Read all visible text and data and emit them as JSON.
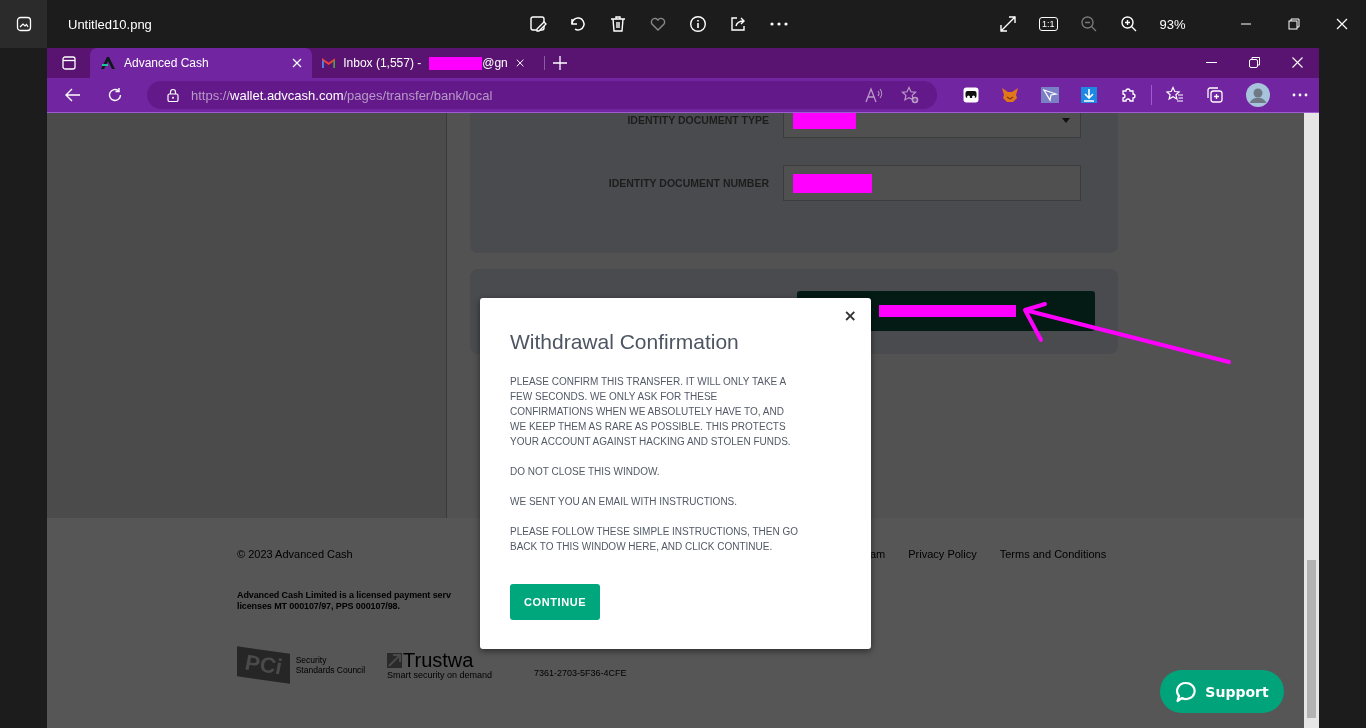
{
  "viewer": {
    "file_name": "Untitled10.png",
    "actual_size": "1:1",
    "zoom": "93%"
  },
  "browser": {
    "tabs": [
      {
        "title": "Advanced Cash",
        "selected": true,
        "redacted": false
      },
      {
        "title": "Inbox (1,557) -",
        "selected": false,
        "redacted": true,
        "suffix": "@gn"
      }
    ],
    "address": {
      "scheme": "https://",
      "host": "wallet.advcash.com",
      "path": "/pages/transfer/bank/local"
    }
  },
  "form": {
    "fields": [
      {
        "label": "IDENTITY DOCUMENT TYPE",
        "kind": "select",
        "redacted": true
      },
      {
        "label": "IDENTITY DOCUMENT NUMBER",
        "kind": "text",
        "redacted": true
      }
    ],
    "submit": {
      "redacted": true
    }
  },
  "footer": {
    "copyright": "© 2023 Advanced Cash",
    "legal": [
      "Advanced Cash Limited is a licensed payment serv",
      "licenses MT 000107/97, PPS 000107/98."
    ],
    "links": [
      "am",
      "Privacy Policy",
      "Terms and Conditions"
    ],
    "pci": {
      "mark": "PCi",
      "lines": [
        "Security",
        "Standards Council"
      ]
    },
    "trustwave": {
      "name": "Trustwa",
      "tagline": "Smart security on demand"
    },
    "code": "7361-2703-5F36-4CFE"
  },
  "modal": {
    "title": "Withdrawal Confirmation",
    "close": "×",
    "paragraphs": [
      "PLEASE CONFIRM THIS TRANSFER. IT WILL ONLY TAKE A FEW SECONDS. WE ONLY ASK FOR THESE CONFIRMATIONS WHEN WE ABSOLUTELY HAVE TO, AND WE KEEP THEM AS RARE AS POSSIBLE. THIS PROTECTS YOUR ACCOUNT AGAINST HACKING AND STOLEN FUNDS.",
      "DO NOT CLOSE THIS WINDOW.",
      "WE SENT YOU AN EMAIL WITH INSTRUCTIONS.",
      "PLEASE FOLLOW THESE SIMPLE INSTRUCTIONS, THEN GO BACK TO THIS WINDOW HERE, AND CLICK CONTINUE."
    ],
    "button": "CONTINUE"
  },
  "support": {
    "label": "Support"
  }
}
